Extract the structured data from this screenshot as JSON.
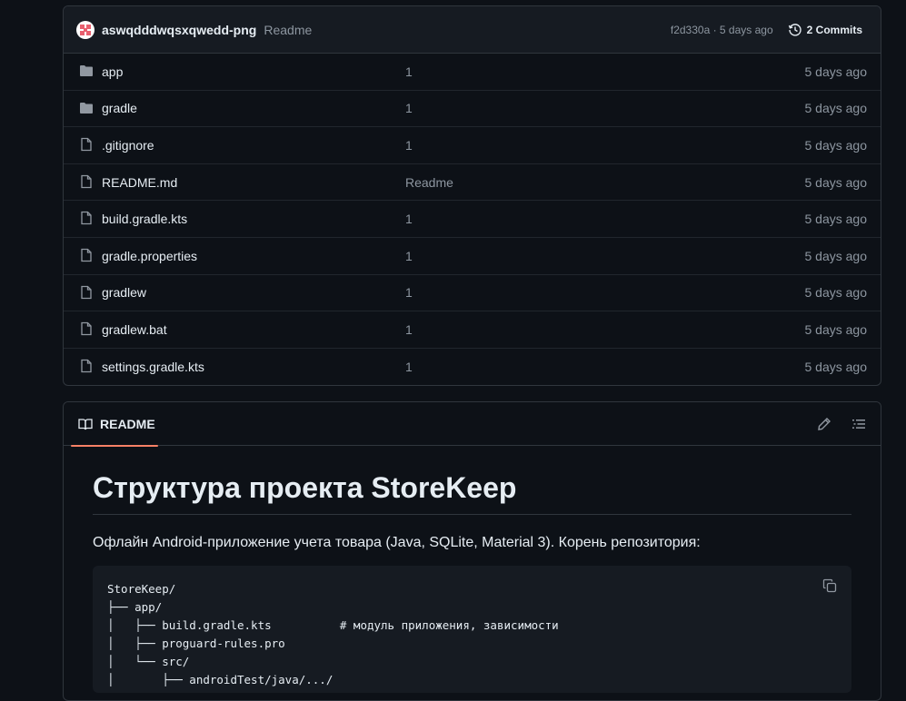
{
  "commit": {
    "author": "aswqdddwqsxqwedd-png",
    "message": "Readme",
    "hash_time": "f2d330a · 5 days ago",
    "commits_label": "2 Commits"
  },
  "files": [
    {
      "name": "app",
      "type": "folder",
      "message": "1",
      "date": "5 days ago"
    },
    {
      "name": "gradle",
      "type": "folder",
      "message": "1",
      "date": "5 days ago"
    },
    {
      "name": ".gitignore",
      "type": "file",
      "message": "1",
      "date": "5 days ago"
    },
    {
      "name": "README.md",
      "type": "file",
      "message": "Readme",
      "date": "5 days ago"
    },
    {
      "name": "build.gradle.kts",
      "type": "file",
      "message": "1",
      "date": "5 days ago"
    },
    {
      "name": "gradle.properties",
      "type": "file",
      "message": "1",
      "date": "5 days ago"
    },
    {
      "name": "gradlew",
      "type": "file",
      "message": "1",
      "date": "5 days ago"
    },
    {
      "name": "gradlew.bat",
      "type": "file",
      "message": "1",
      "date": "5 days ago"
    },
    {
      "name": "settings.gradle.kts",
      "type": "file",
      "message": "1",
      "date": "5 days ago"
    }
  ],
  "readme": {
    "tab_label": "README",
    "title": "Структура проекта StoreKeep",
    "intro": "Офлайн Android-приложение учета товара (Java, SQLite, Material 3). Корень репозитория:",
    "code_lines": [
      "StoreKeep/",
      "├── app/",
      "│   ├── build.gradle.kts          # модуль приложения, зависимости",
      "│   ├── proguard-rules.pro",
      "│   └── src/",
      "│       ├── androidTest/java/.../"
    ]
  },
  "colors": {
    "background": "#0d1117",
    "accent_tab": "#f78166",
    "muted_text": "#8d96a0",
    "folder_icon": "#9198a1"
  }
}
